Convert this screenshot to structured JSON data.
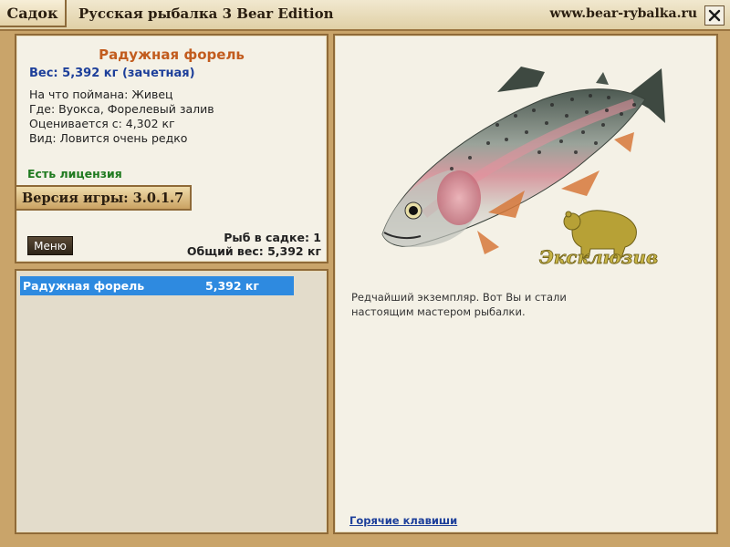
{
  "topbar": {
    "tab_label": "Садок",
    "app_title": "Русская рыбалка 3 Bear Edition",
    "site": "www.bear-rybalka.ru"
  },
  "info": {
    "fish_name": "Радужная форель",
    "weight": "Вес: 5,392 кг (зачетная)",
    "caught_on": "На что поймана: Живец",
    "where": "Где: Вуокса, Форелевый залив",
    "valued_from": "Оценивается с: 4,302 кг",
    "kind": "Вид: Ловится очень редко",
    "license": "Есть лицензия",
    "version": "Версия игры: 3.0.1.7",
    "menu_label": "Меню",
    "fish_count": "Рыб в садке: 1",
    "total_weight": "Общий вес: 5,392 кг"
  },
  "list": {
    "items": [
      {
        "name": "Радужная форель",
        "weight": "5,392 кг"
      }
    ]
  },
  "detail": {
    "description": "Редчайший экземпляр. Вот Вы и стали настоящим мастером рыбалки.",
    "badge_text": "Эксклюзив",
    "hotkeys_label": "Горячие клавиши"
  },
  "icons": {
    "close": "close-icon",
    "fish": "trout-image",
    "bear": "bear-icon"
  },
  "colors": {
    "title_orange": "#c25c1e",
    "weight_blue": "#1d3f9a",
    "license_green": "#1f7a1f",
    "selection_blue": "#2e8ae0",
    "frame_brown": "#8f6a38"
  }
}
